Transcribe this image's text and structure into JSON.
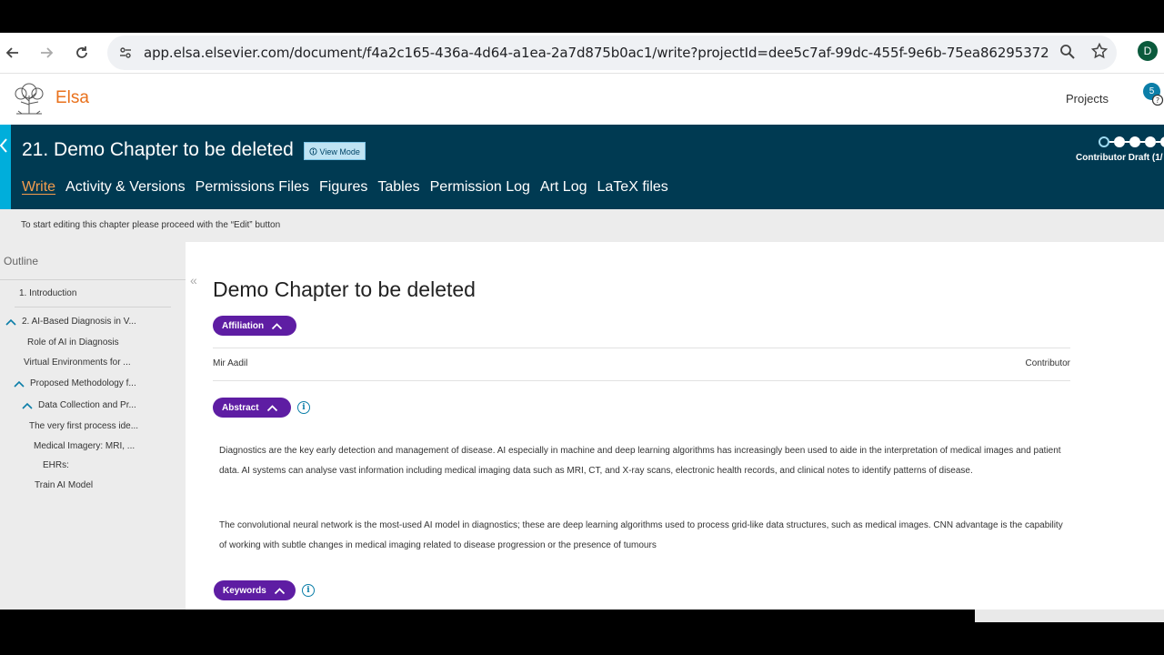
{
  "browser": {
    "url": "app.elsa.elsevier.com/document/f4a2c165-436a-4d64-a1ea-2a7d875b0ac1/write?projectId=dee5c7af-99dc-455f-9e6b-75ea86295372",
    "profile_initial": "D"
  },
  "app": {
    "brand": "Elsa",
    "projects_label": "Projects",
    "notification_count": "5"
  },
  "chapter": {
    "title": "21. Demo Chapter to be deleted",
    "view_mode_label": "View Mode",
    "stage_label": "Contributor Draft (1/",
    "tabs": [
      {
        "label": "Write",
        "active": true
      },
      {
        "label": "Activity & Versions"
      },
      {
        "label": "Permissions Files"
      },
      {
        "label": "Figures"
      },
      {
        "label": "Tables"
      },
      {
        "label": "Permission Log"
      },
      {
        "label": "Art Log"
      },
      {
        "label": "LaTeX files"
      }
    ]
  },
  "notice": {
    "text": "To start editing this chapter please proceed with the “Edit” button"
  },
  "outline": {
    "title": "Outline",
    "items": [
      {
        "label": "1. Introduction"
      },
      {
        "label": "2. AI-Based Diagnosis in V..."
      },
      {
        "label": "Role of AI in Diagnosis"
      },
      {
        "label": "Virtual Environments for ..."
      },
      {
        "label": "Proposed Methodology f..."
      },
      {
        "label": "Data Collection and Pr..."
      },
      {
        "label": "The very first process ide..."
      },
      {
        "label": "Medical Imagery: MRI, ..."
      },
      {
        "label": "EHRs:"
      },
      {
        "label": "Train AI Model"
      }
    ]
  },
  "document": {
    "title": "Demo Chapter to be deleted",
    "affiliation_label": "Affiliation",
    "author_name": "Mir Aadil",
    "author_role": "Contributor",
    "abstract_label": "Abstract",
    "abstract_paragraphs": [
      "Diagnostics are the key early detection and management of disease. AI especially in machine and deep learning algorithms has increasingly been used to aide in the interpretation of medical images and patient data. AI systems can analyse vast information including medical imaging data such as MRI, CT, and X-ray scans, electronic health records, and clinical notes to identify patterns of disease.",
      "The convolutional neural network is the most-used AI model in diagnostics; these are deep learning algorithms used to process grid-like data structures, such as medical images. CNN advantage is the capability of working with subtle changes in medical imaging related to disease progression or the presence of tumours"
    ],
    "keywords_label": "Keywords"
  },
  "colors": {
    "banner": "#003a52",
    "accent": "#00aedb",
    "brand": "#e9711c",
    "pill": "#5e1da3",
    "active_tab": "#f39d4d"
  }
}
